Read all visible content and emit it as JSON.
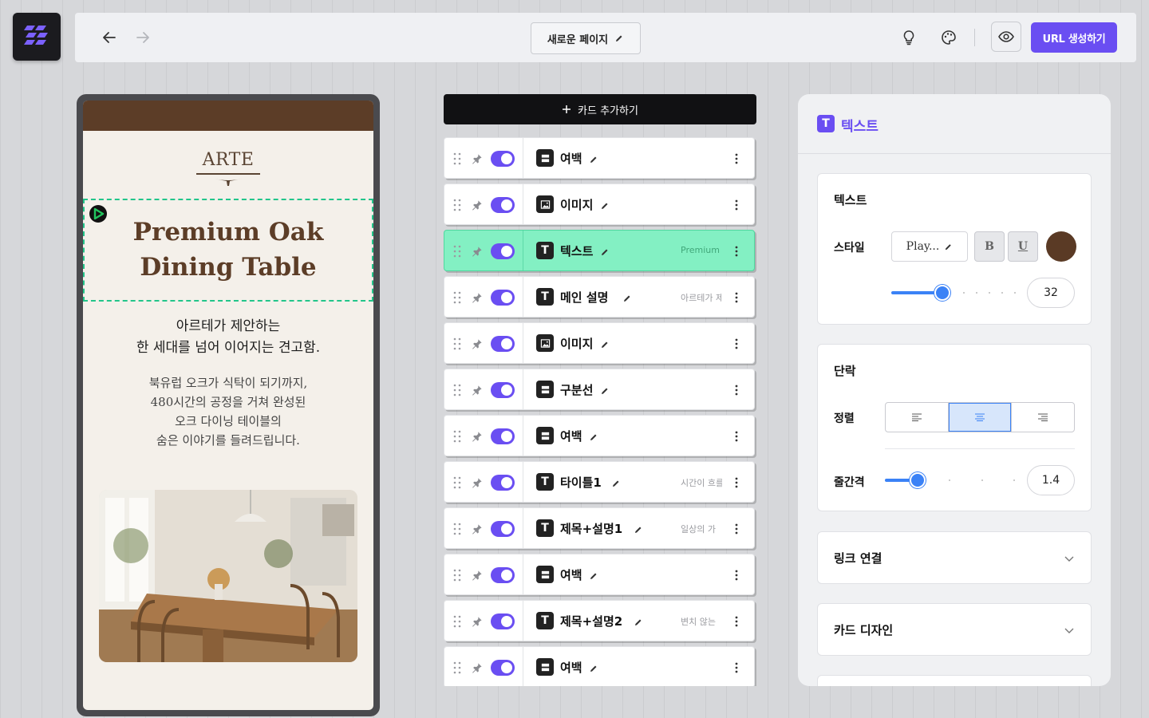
{
  "topbar": {
    "page_title": "새로운 페이지",
    "url_button": "URL 생성하기"
  },
  "preview": {
    "brand": "ARTE",
    "hero_title_line1": "Premium Oak",
    "hero_title_line2": "Dining Table",
    "subtitle_line1": "아르테가 제안하는",
    "subtitle_line2": "한 세대를 넘어 이어지는 견고함.",
    "desc_line1": "북유럽 오크가 식탁이 되기까지,",
    "desc_line2": "480시간의 공정을 거쳐 완성된",
    "desc_line3": "오크 다이닝 테이블의",
    "desc_line4": "숨은 이야기를 들려드립니다."
  },
  "card_list": {
    "add_label": "카드 추가하기",
    "cards": [
      {
        "name": "여백",
        "type": "spacer",
        "preview": ""
      },
      {
        "name": "이미지",
        "type": "image",
        "preview": ""
      },
      {
        "name": "텍스트",
        "type": "text",
        "preview": "Premium O",
        "active": true
      },
      {
        "name": "메인 설명",
        "type": "text",
        "preview": "아르테가 제"
      },
      {
        "name": "이미지",
        "type": "image",
        "preview": ""
      },
      {
        "name": "구분선",
        "type": "spacer",
        "preview": ""
      },
      {
        "name": "여백",
        "type": "spacer",
        "preview": ""
      },
      {
        "name": "타이틀1",
        "type": "text",
        "preview": "시간이 흐를"
      },
      {
        "name": "제목+설명1",
        "type": "text",
        "preview": "일상의 가"
      },
      {
        "name": "여백",
        "type": "spacer",
        "preview": ""
      },
      {
        "name": "제목+설명2",
        "type": "text",
        "preview": "변치 않는"
      },
      {
        "name": "여백",
        "type": "spacer",
        "preview": ""
      }
    ]
  },
  "panel": {
    "title": "텍스트",
    "text_section": {
      "title": "텍스트",
      "style_label": "스타일",
      "font_value": "Play...",
      "bold": "B",
      "underline": "U",
      "color": "#5a3a25",
      "size_value": "32"
    },
    "paragraph_section": {
      "title": "단락",
      "align_label": "정렬",
      "align_selected": "center",
      "line_height_label": "줄간격",
      "line_height_value": "1.4"
    },
    "link_section": {
      "title": "링크 연결"
    },
    "card_design_section": {
      "title": "카드 디자인"
    }
  },
  "colors": {
    "accent": "#6a4ef2",
    "active_card": "#83f0c3",
    "slider": "#3b82f6",
    "header_brown": "#5c3d27"
  }
}
